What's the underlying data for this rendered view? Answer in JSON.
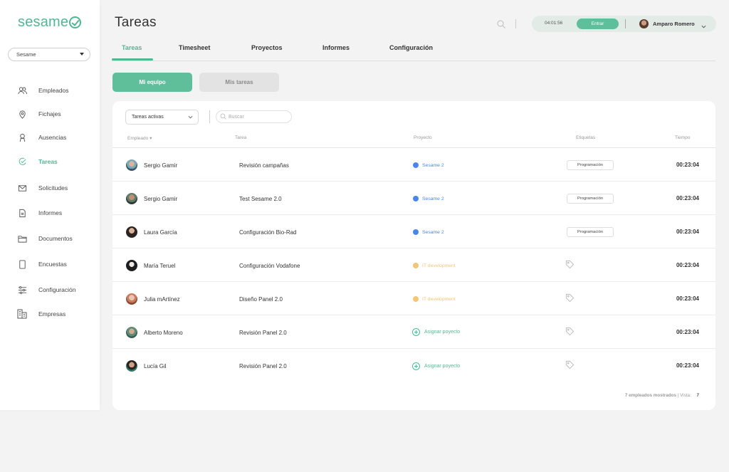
{
  "sidebar": {
    "logo": "sesame",
    "company": "Sesame",
    "items": [
      {
        "label": "Empleados",
        "icon": "users-icon"
      },
      {
        "label": "Fichajes",
        "icon": "location-pin-icon"
      },
      {
        "label": "Ausencias",
        "icon": "person-icon"
      },
      {
        "label": "Tareas",
        "icon": "tasks-icon"
      },
      {
        "label": "Solicitudes",
        "icon": "envelope-icon"
      },
      {
        "label": "Informes",
        "icon": "document-icon"
      },
      {
        "label": "Documentos",
        "icon": "folder-icon"
      },
      {
        "label": "Encuestas",
        "icon": "tablet-icon"
      },
      {
        "label": "Configuración",
        "icon": "sliders-icon"
      },
      {
        "label": "Empresas",
        "icon": "buildings-icon"
      }
    ],
    "active": "Tareas"
  },
  "header": {
    "title": "Tareas",
    "clock": "04:01:56",
    "enter_label": "Entrar",
    "user_name": "Amparo Romero"
  },
  "tabs": [
    "Tareas",
    "Timesheet",
    "Proyectos",
    "Informes",
    "Configuración"
  ],
  "segments": {
    "mine_team": "Mi equipo",
    "my_tasks": "Mis tareas"
  },
  "filters": {
    "status": "Tareas activas",
    "search_placeholder": "Buscar"
  },
  "table": {
    "columns": {
      "employee": "Empleado",
      "task": "Tarea",
      "project": "Proyecto",
      "tags": "Etiquetas",
      "time": "Tiempo"
    },
    "rows": [
      {
        "employee": "Sergio Gamir",
        "task": "Revisión campañas",
        "project": "Sesame 2",
        "project_color": "#4a86e8",
        "tag": "Programación",
        "time": "00:23:04"
      },
      {
        "employee": "Sergio Gamir",
        "task": "Test Sesame 2.0",
        "project": "Sesame 2",
        "project_color": "#4a86e8",
        "tag": "Programación",
        "time": "00:23:04"
      },
      {
        "employee": "Laura García",
        "task": "Configuración Bio-Rad",
        "project": "Sesame 2",
        "project_color": "#4a86e8",
        "tag": "Programación",
        "time": "00:23:04"
      },
      {
        "employee": "María Teruel",
        "task": "Configuración Vodafone",
        "project": "IT development",
        "project_color": "#f3c677",
        "tag": "",
        "time": "00:23:04"
      },
      {
        "employee": "Julia mArtínez",
        "task": "Diseño Panel 2.0",
        "project": "IT development",
        "project_color": "#f3c677",
        "tag": "",
        "time": "00:23:04"
      },
      {
        "employee": "Alberto Moreno",
        "task": "Revisión Panel 2.0",
        "project": "",
        "assign_label": "Asignar poyecto",
        "tag": "",
        "time": "00:23:04"
      },
      {
        "employee": "Lucía Gil",
        "task": "Revisión Panel 2.0",
        "project": "",
        "assign_label": "Asignar poyecto",
        "tag": "",
        "time": "00:23:04"
      }
    ]
  },
  "footer": {
    "shown": "7 empleados mostrados",
    "view_label": "Vista:",
    "view_count": "7"
  },
  "colors": {
    "accent": "#4fb893",
    "sesame_blue": "#4a86e8",
    "it_yellow": "#f3c677"
  }
}
